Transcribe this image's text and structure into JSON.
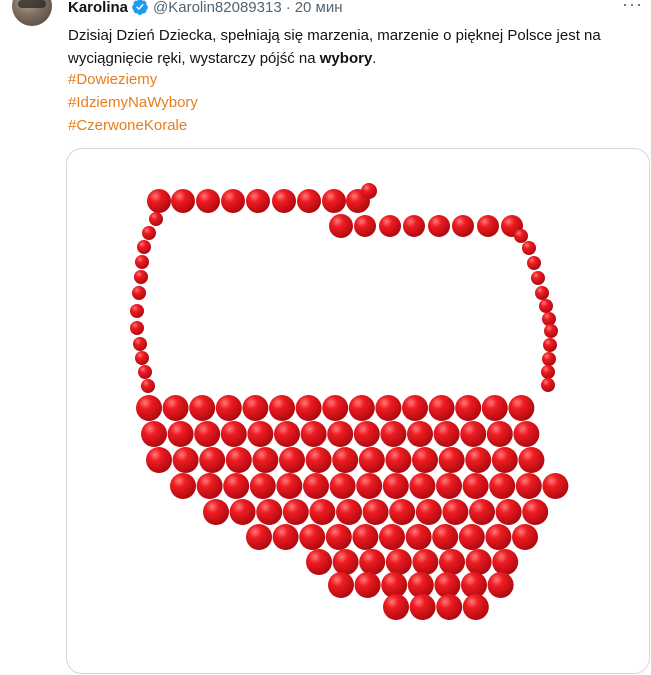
{
  "tweet": {
    "author_name": "Karolina",
    "handle": "@Karolin82089313",
    "separator": "·",
    "time": "20 мин",
    "more_icon": "more-icon",
    "verified_icon": "verified-badge-icon",
    "text_part1": "Dzisiaj Dzień Dziecka, spełniają się marzenia, marzenie o pięknej Polsce jest na wyciągnięcie ręki, wystarczy pójść na ",
    "text_bold": "wybory",
    "text_part2": ".",
    "hashtags": [
      "#Dowieziemy",
      "#IdziemyNaWybory",
      "#CzerwoneKorale"
    ],
    "media": {
      "description_icon": "bead-map-image",
      "bead_color": "#e0141b",
      "bead_highlight": "#ff6a6a"
    }
  },
  "colors": {
    "hashtag": "#e57e1b",
    "verified": "#1d9bf0",
    "secondary_text": "#536471"
  }
}
